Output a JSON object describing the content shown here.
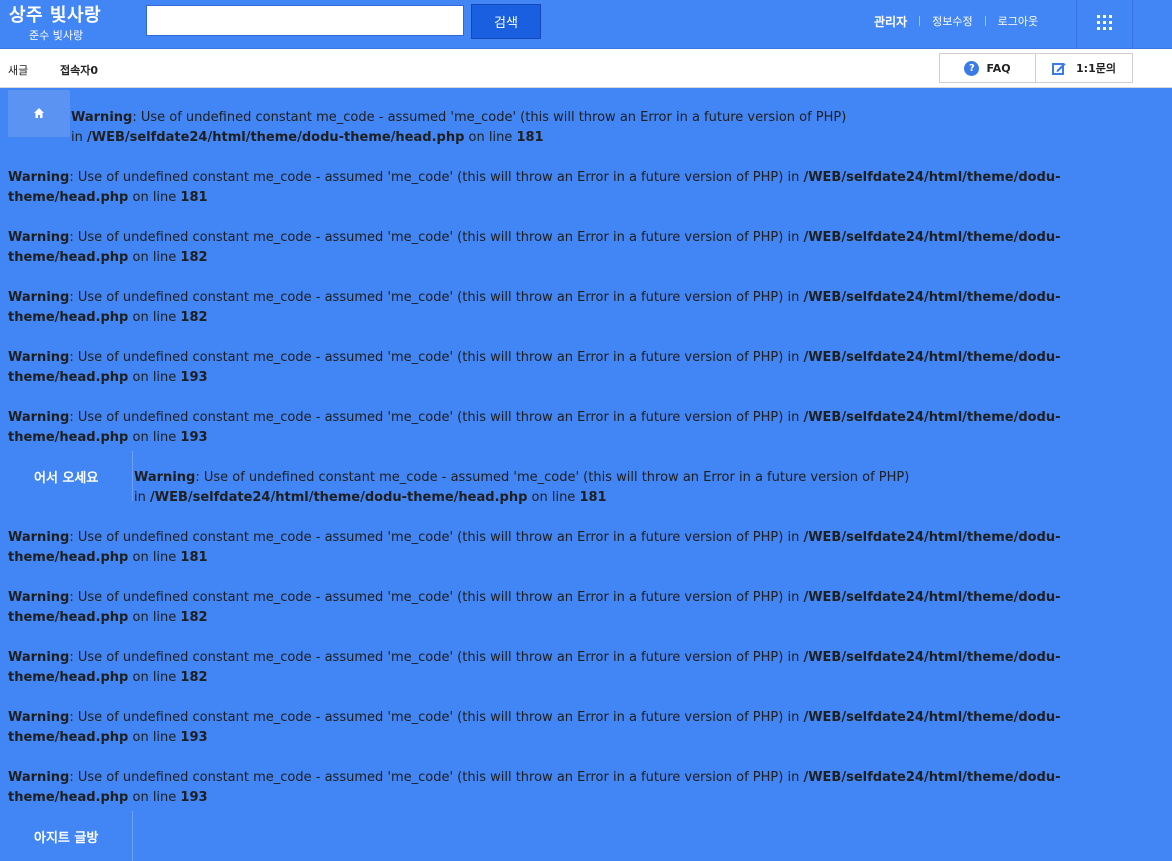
{
  "header": {
    "logo_title": "상주 빛사랑",
    "logo_sub": "준수 빛사랑",
    "search_placeholder": "",
    "search_value": "",
    "search_button": "검색",
    "links": [
      "관리자",
      "정보수정",
      "로그아웃"
    ],
    "apps_icon": "apps-grid-icon"
  },
  "subbar": {
    "new_posts": "새글",
    "visitors": "접속자0",
    "faq": "FAQ",
    "inquiry": "1:1문의"
  },
  "sidebar": {
    "home_icon": "home-icon",
    "tabs": [
      "어서 오세요",
      "아지트 글방"
    ]
  },
  "warnings": {
    "label": "Warning",
    "message": ": Use of undefined constant me_code - assumed 'me_code' (this will throw an Error in a future version of PHP)",
    "in_word": " in ",
    "in_word_wrapped": "in ",
    "path": "/WEB/selfdate24/html/theme/dodu-theme/head.php",
    "path_part1": "/WEB/selfdate24/html/theme/dodu-",
    "path_part2": "theme/head.php",
    "on_line": " on line ",
    "lines": [
      "181",
      "181",
      "182",
      "182",
      "193",
      "193",
      "181",
      "181",
      "182",
      "182",
      "193",
      "193"
    ]
  }
}
